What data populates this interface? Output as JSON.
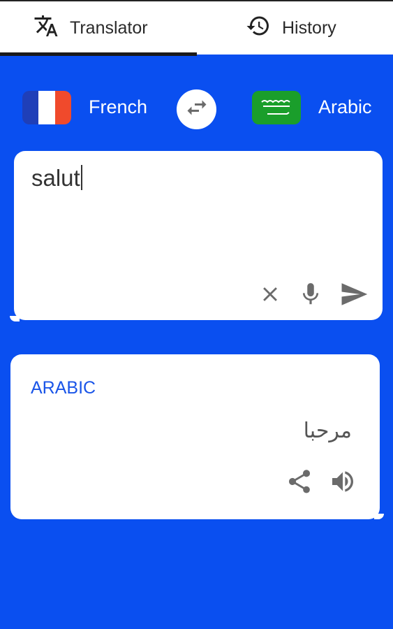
{
  "tabs": {
    "translator_label": "Translator",
    "history_label": "History",
    "active": "translator"
  },
  "languages": {
    "source": "French",
    "target": "Arabic",
    "source_flag": "france-flag",
    "target_flag": "saudi-arabia-flag"
  },
  "input": {
    "text": "salut"
  },
  "output": {
    "language_label": "ARABIC",
    "text": "مرحبا"
  },
  "colors": {
    "background": "#0a4ff0",
    "accent_label": "#1a55e8",
    "icon_gray": "#6b6b6b"
  },
  "icons": {
    "translate": "translate-icon",
    "history": "history-icon",
    "swap": "swap-icon",
    "clear": "close-icon",
    "mic": "mic-icon",
    "send": "send-icon",
    "share": "share-icon",
    "speaker": "speaker-icon"
  }
}
